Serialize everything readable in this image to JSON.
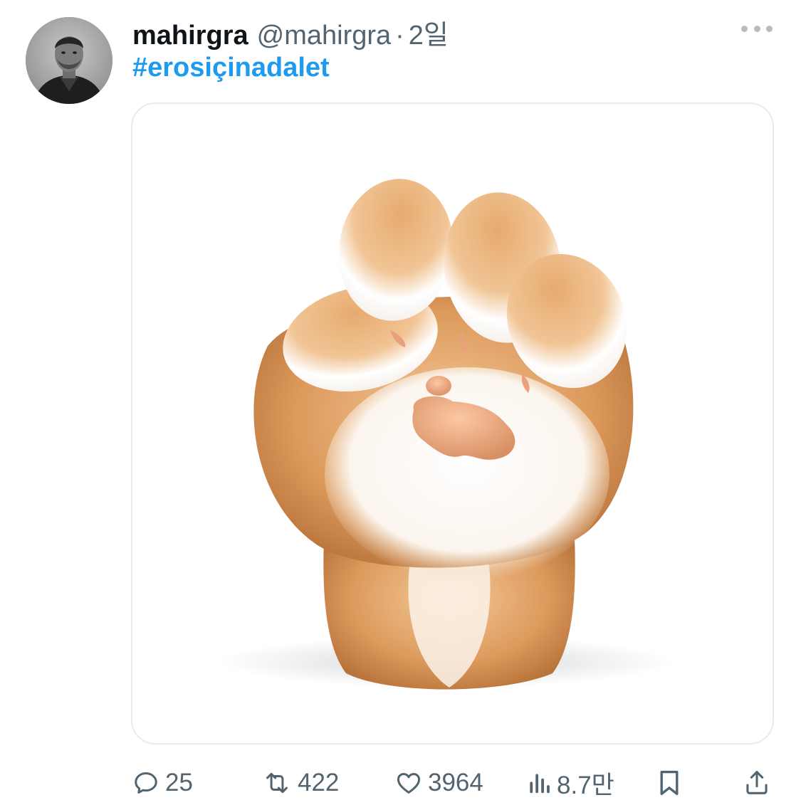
{
  "tweet": {
    "display_name": "mahirgra",
    "handle": "@mahirgra",
    "separator": "·",
    "time": "2일",
    "hashtag": "#erosiçinadalet"
  },
  "icons": {
    "more": "more-icon",
    "reply": "reply-icon",
    "retweet": "retweet-icon",
    "like": "heart-icon",
    "views": "views-icon",
    "bookmark": "bookmark-icon",
    "share": "share-icon"
  },
  "actions": {
    "replies": "25",
    "retweets": "422",
    "likes": "3964",
    "views": "8.7만"
  },
  "colors": {
    "hashtag": "#1d9bf0",
    "secondary_text": "#536471",
    "icon": "#536471"
  }
}
